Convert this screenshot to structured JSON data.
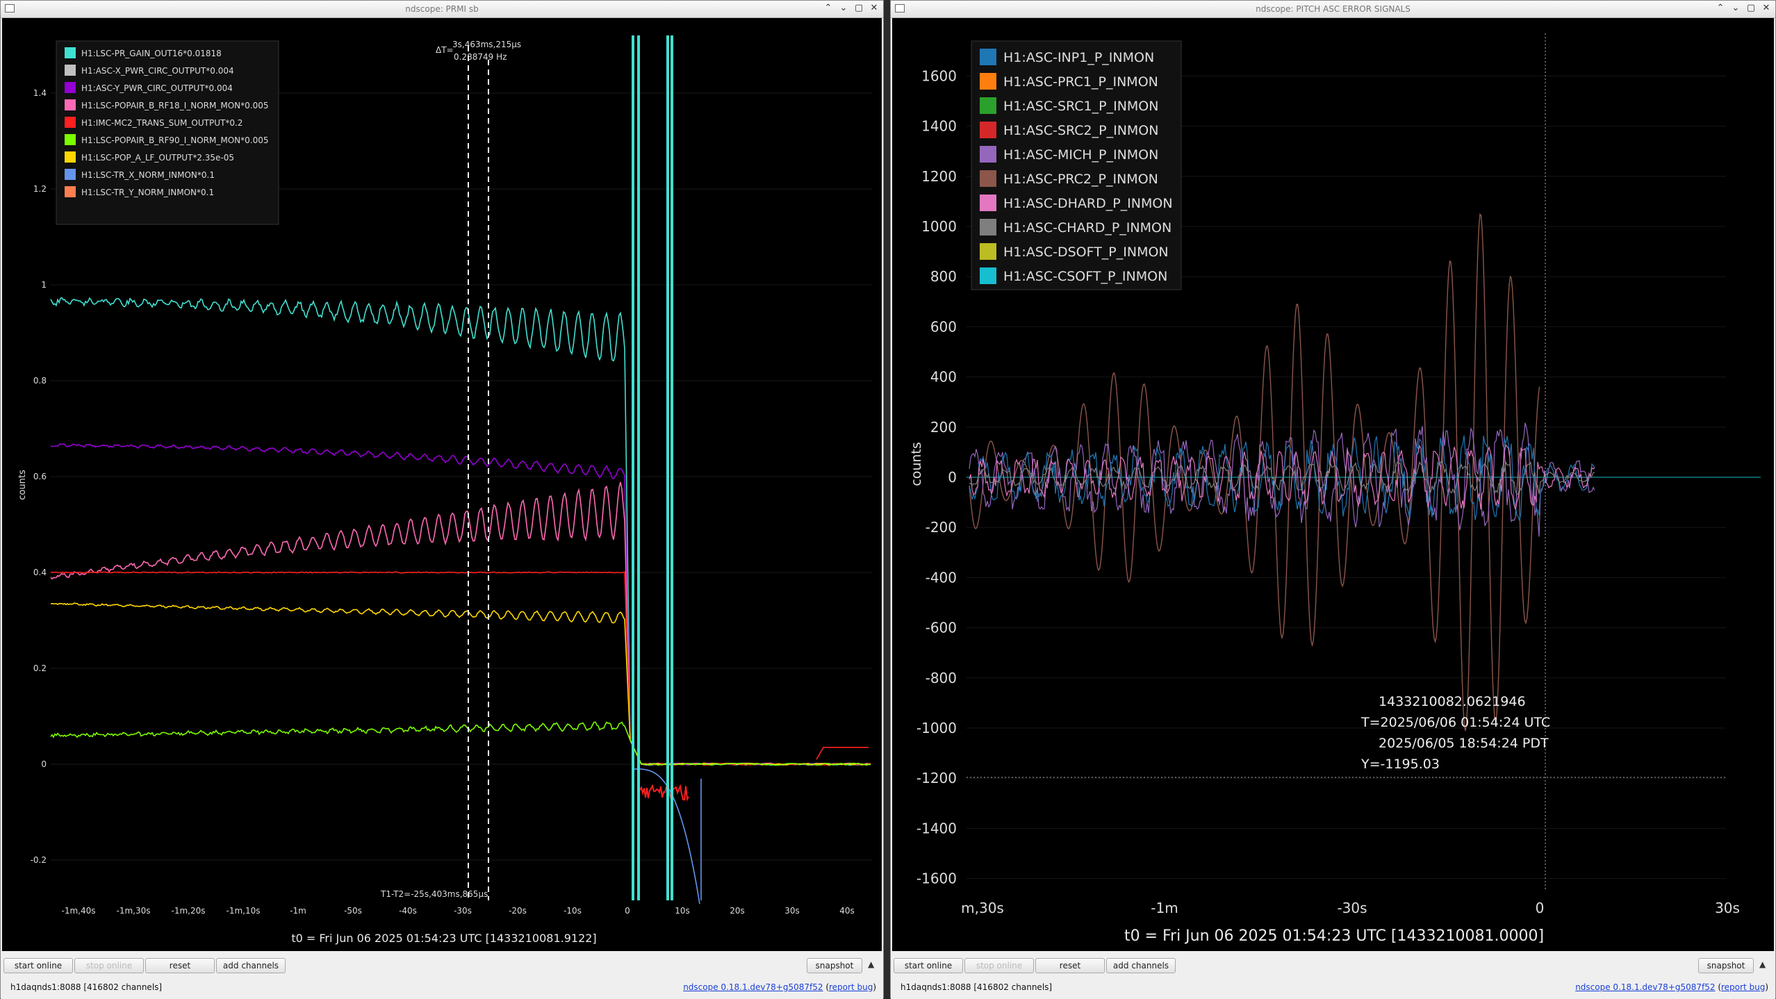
{
  "windows": [
    {
      "title": "ndscope: PRMI sb",
      "ylabel": "counts",
      "t0_label": "t0 = Fri Jun 06 2025 01:54:23 UTC [1433210081.9122]",
      "cursor": {
        "dt_label": "ΔT=",
        "dt_value": "3s,463ms,215µs",
        "freq": "0.288749 Hz",
        "t1t2": "T1-T2=-25s,403ms,865µs"
      },
      "legend": [
        {
          "name": "H1:LSC-PR_GAIN_OUT16*0.01818",
          "color": "#40e0d0"
        },
        {
          "name": "H1:ASC-X_PWR_CIRC_OUTPUT*0.004",
          "color": "#c0c0c0"
        },
        {
          "name": "H1:ASC-Y_PWR_CIRC_OUTPUT*0.004",
          "color": "#9400d3"
        },
        {
          "name": "H1:LSC-POPAIR_B_RF18_I_NORM_MON*0.005",
          "color": "#ff69b4"
        },
        {
          "name": "H1:IMC-MC2_TRANS_SUM_OUTPUT*0.2",
          "color": "#ff2020"
        },
        {
          "name": "H1:LSC-POPAIR_B_RF90_I_NORM_MON*0.005",
          "color": "#7cfc00"
        },
        {
          "name": "H1:LSC-POP_A_LF_OUTPUT*2.35e-05",
          "color": "#ffd700"
        },
        {
          "name": "H1:LSC-TR_X_NORM_INMON*0.1",
          "color": "#6495ed"
        },
        {
          "name": "H1:LSC-TR_Y_NORM_INMON*0.1",
          "color": "#ff7f50"
        }
      ],
      "y_ticks": [
        "1.4",
        "1.2",
        "1",
        "0.8",
        "0.6",
        "0.4",
        "0.2",
        "0",
        "-0.2"
      ],
      "x_ticks": [
        "-1m,40s",
        "-1m,30s",
        "-1m,20s",
        "-1m,10s",
        "-1m",
        "-50s",
        "-40s",
        "-30s",
        "-20s",
        "-10s",
        "0",
        "10s",
        "20s",
        "30s",
        "40s"
      ]
    },
    {
      "title": "ndscope: PITCH ASC ERROR SIGNALS",
      "ylabel": "counts",
      "t0_label": "t0 = Fri Jun 06 2025 01:54:23 UTC [1433210081.0000]",
      "cursor": {
        "gps": "1433210082.0621946",
        "utc": "T=2025/06/06 01:54:24 UTC",
        "pdt": "2025/06/05 18:54:24 PDT",
        "y": "Y=-1195.03"
      },
      "legend": [
        {
          "name": "H1:ASC-INP1_P_INMON",
          "color": "#1f77b4"
        },
        {
          "name": "H1:ASC-PRC1_P_INMON",
          "color": "#ff7f0e"
        },
        {
          "name": "H1:ASC-SRC1_P_INMON",
          "color": "#2ca02c"
        },
        {
          "name": "H1:ASC-SRC2_P_INMON",
          "color": "#d62728"
        },
        {
          "name": "H1:ASC-MICH_P_INMON",
          "color": "#9467bd"
        },
        {
          "name": "H1:ASC-PRC2_P_INMON",
          "color": "#8c564b"
        },
        {
          "name": "H1:ASC-DHARD_P_INMON",
          "color": "#e377c2"
        },
        {
          "name": "H1:ASC-CHARD_P_INMON",
          "color": "#7f7f7f"
        },
        {
          "name": "H1:ASC-DSOFT_P_INMON",
          "color": "#bcbd22"
        },
        {
          "name": "H1:ASC-CSOFT_P_INMON",
          "color": "#17becf"
        }
      ],
      "y_ticks": [
        "1600",
        "1400",
        "1200",
        "1000",
        "800",
        "600",
        "400",
        "200",
        "0",
        "-200",
        "-400",
        "-600",
        "-800",
        "-1000",
        "-1200",
        "-1400",
        "-1600"
      ],
      "x_ticks": [
        "m,30s",
        "-1m",
        "-30s",
        "0",
        "30s"
      ]
    }
  ],
  "toolbar": {
    "start_online": "start online",
    "stop_online": "stop online",
    "reset": "reset",
    "add_channels": "add channels",
    "snapshot": "snapshot"
  },
  "status": {
    "server": "h1daqnds1:8088",
    "channels": "[416802 channels]",
    "version": "ndscope 0.18.1.dev78+g5087f52",
    "report_bug": "report bug"
  },
  "icons": {
    "app": "window-icon",
    "minimize": "minimize-icon",
    "maximize": "maximize-icon",
    "close": "close-icon",
    "collapse": "chevron-up-icon"
  }
}
